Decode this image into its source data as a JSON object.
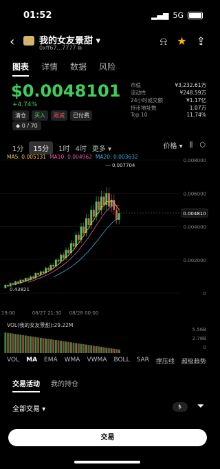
{
  "status": {
    "time": "01:52",
    "network": "5G"
  },
  "header": {
    "title": "我的女友景甜 ▾",
    "address": "0xff67...7777 ⧉"
  },
  "tabs": [
    "图表",
    "详情",
    "数据",
    "风险"
  ],
  "price": {
    "value": "$0.0048101",
    "change": "+4.74%"
  },
  "badges": [
    {
      "label": "清仓",
      "cls": ""
    },
    {
      "label": "买入",
      "cls": "g"
    },
    {
      "label": "跟减",
      "cls": "r"
    },
    {
      "label": "已付费",
      "cls": ""
    }
  ],
  "holders_badge": "◆ 0 / 70",
  "stats": [
    {
      "k": "市值",
      "v": "¥3,232.61万"
    },
    {
      "k": "流动性",
      "v": "¥248.59万"
    },
    {
      "k": "24小时成交额",
      "v": "¥1.17亿"
    },
    {
      "k": "持币地址数",
      "v": "1.07万"
    },
    {
      "k": "Top 10",
      "v": "11.74%"
    }
  ],
  "timeframes": [
    "1分",
    "15分",
    "1时",
    "4时",
    "更多 ▾"
  ],
  "price_toggle": "价格 ▾",
  "ma": {
    "ma5": "MA5: 0.005131",
    "ma10": "MA10: 0.004962",
    "ma20": "MA20: 0.003632"
  },
  "chart_data": {
    "type": "candlestick",
    "y_ticks": [
      "0.008000",
      "0.006000",
      "0.004000",
      "0.002000",
      "0"
    ],
    "x_ticks": [
      "19:00",
      "08/27 21:30",
      "08/28 00:00"
    ],
    "high_label": "0.007704",
    "low_label": "0.43821",
    "current_label": "0.004810",
    "ylim": [
      0,
      0.008
    ],
    "candles": [
      [
        0.0003,
        0.0005
      ],
      [
        0.0005,
        0.0004
      ],
      [
        0.0004,
        0.0006
      ],
      [
        0.0006,
        0.0005
      ],
      [
        0.0005,
        0.0007
      ],
      [
        0.0007,
        0.0006
      ],
      [
        0.0006,
        0.0008
      ],
      [
        0.0008,
        0.0007
      ],
      [
        0.0007,
        0.0009
      ],
      [
        0.0009,
        0.0008
      ],
      [
        0.0008,
        0.001
      ],
      [
        0.001,
        0.0009
      ],
      [
        0.0009,
        0.0012
      ],
      [
        0.0012,
        0.0011
      ],
      [
        0.0011,
        0.0013
      ],
      [
        0.0013,
        0.0012
      ],
      [
        0.0012,
        0.0015
      ],
      [
        0.0015,
        0.0014
      ],
      [
        0.0014,
        0.0017
      ],
      [
        0.0017,
        0.0016
      ],
      [
        0.0016,
        0.002
      ],
      [
        0.002,
        0.0019
      ],
      [
        0.0019,
        0.0023
      ],
      [
        0.0023,
        0.0021
      ],
      [
        0.0021,
        0.0026
      ],
      [
        0.0026,
        0.0024
      ],
      [
        0.0024,
        0.003
      ],
      [
        0.003,
        0.0028
      ],
      [
        0.0028,
        0.0035
      ],
      [
        0.0035,
        0.0032
      ],
      [
        0.0032,
        0.004
      ],
      [
        0.004,
        0.0036
      ],
      [
        0.0036,
        0.0045
      ],
      [
        0.0045,
        0.0041
      ],
      [
        0.0041,
        0.005
      ],
      [
        0.005,
        0.0046
      ],
      [
        0.0046,
        0.0055
      ],
      [
        0.0055,
        0.005
      ],
      [
        0.005,
        0.0058
      ],
      [
        0.0058,
        0.0053
      ],
      [
        0.0053,
        0.006
      ],
      [
        0.006,
        0.0052
      ],
      [
        0.0052,
        0.0056
      ],
      [
        0.0056,
        0.005
      ],
      [
        0.005,
        0.0044
      ],
      [
        0.0044,
        0.0048
      ]
    ]
  },
  "volume_label": "VOL(我的女友景甜):29.22M",
  "volume_ticks": [
    "5.56B",
    "2.78B",
    "0"
  ],
  "indicators": [
    "VOL",
    "MA",
    "EMA",
    "WMA",
    "VWMA",
    "BOLL",
    "SAR",
    "撑压线",
    "超级趋势"
  ],
  "sub_tabs": [
    "交易活动",
    "我的持仓"
  ],
  "filter_label": "全部交易 ▾",
  "trade_button": "交易",
  "colors": {
    "up": "#3ecf5a",
    "down": "#e35a5a"
  }
}
